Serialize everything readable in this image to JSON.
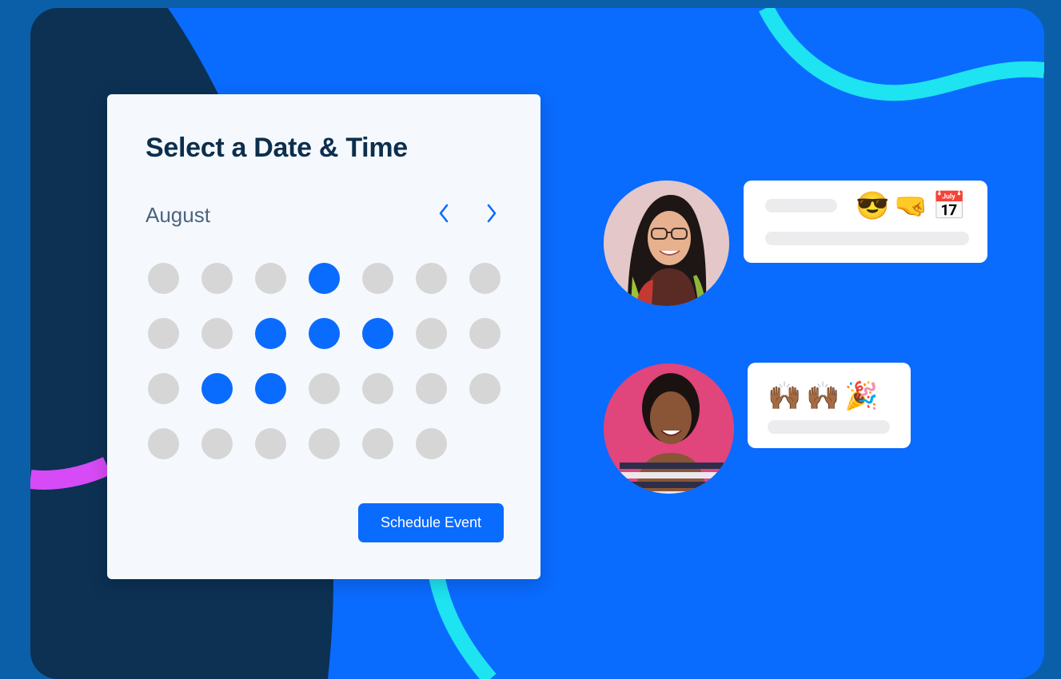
{
  "card": {
    "title": "Select a Date & Time",
    "month": "August",
    "schedule_label": "Schedule Event"
  },
  "calendar": {
    "rows": [
      [
        "unavailable",
        "unavailable",
        "unavailable",
        "available",
        "unavailable",
        "unavailable",
        "unavailable"
      ],
      [
        "unavailable",
        "unavailable",
        "available",
        "available",
        "available",
        "unavailable",
        "unavailable"
      ],
      [
        "unavailable",
        "available",
        "available",
        "unavailable",
        "unavailable",
        "unavailable",
        "unavailable"
      ],
      [
        "unavailable",
        "unavailable",
        "unavailable",
        "unavailable",
        "unavailable",
        "unavailable",
        "empty"
      ]
    ]
  },
  "chat": {
    "message_1_emojis": [
      "😎",
      "🤜",
      "📅"
    ],
    "message_2_emojis": [
      "🙌🏾",
      "🙌🏾",
      "🎉"
    ]
  },
  "icons": {
    "prev": "chevron-left-icon",
    "next": "chevron-right-icon"
  },
  "colors": {
    "brand_blue": "#0a6bff",
    "navy": "#0d2e4d",
    "background": "#0b5fa8",
    "unavailable_day": "#d6d6d6",
    "accent_cyan": "#1ee3f0",
    "accent_magenta": "#d64bf5"
  }
}
